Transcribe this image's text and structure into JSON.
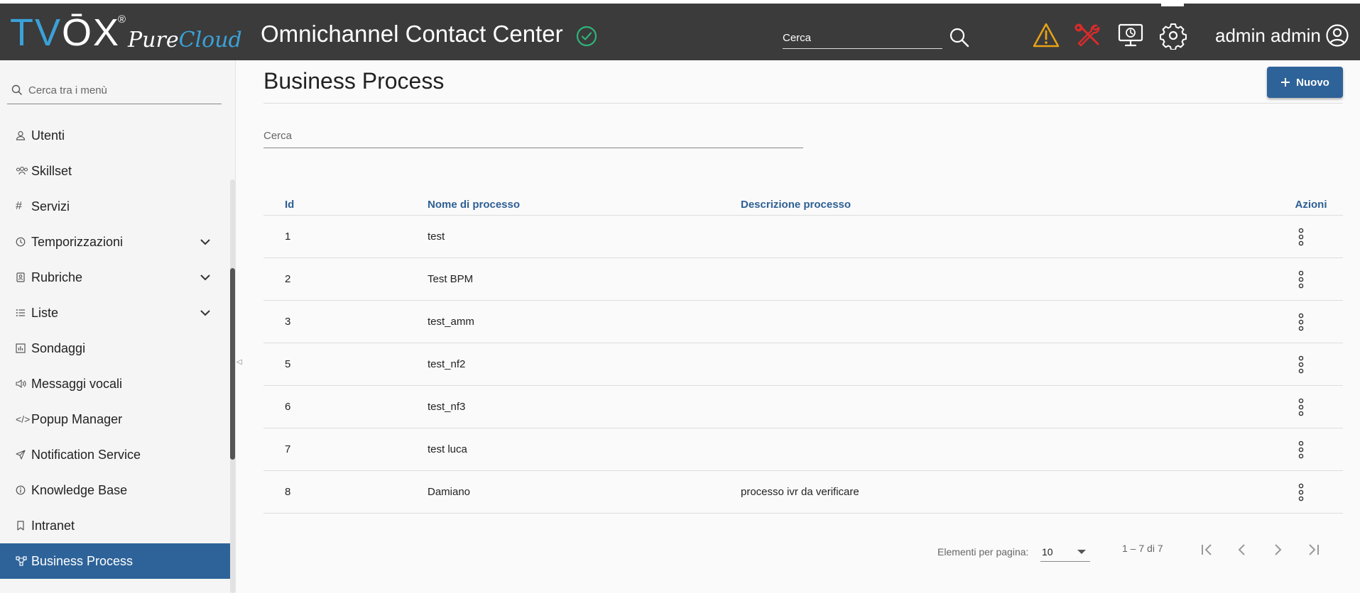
{
  "header": {
    "logo_text": "TVOX",
    "logo_reg": "®",
    "logo_sub1": "Pure",
    "logo_sub2": "Cloud",
    "app_title": "Omnichannel Contact Center",
    "search_placeholder": "Cerca",
    "user_name": "admin admin",
    "icons": [
      "check-circle-icon",
      "search-icon",
      "warning-icon",
      "tools-icon",
      "monitor-clock-icon",
      "gear-icon",
      "user-circle-icon"
    ],
    "colors": {
      "bar": "#3b3b3b",
      "brand": "#3ba1d8",
      "warning": "#e8a317",
      "tools": "#d92b2b",
      "ok": "#2fb37a"
    }
  },
  "sidebar": {
    "search_placeholder": "Cerca tra i menù",
    "items": [
      {
        "label": "Utenti",
        "icon": "user-icon",
        "expandable": false,
        "active": false
      },
      {
        "label": "Skillset",
        "icon": "users-group-icon",
        "expandable": false,
        "active": false
      },
      {
        "label": "Servizi",
        "icon": "hash-icon",
        "expandable": false,
        "active": false
      },
      {
        "label": "Temporizzazioni",
        "icon": "clock-icon",
        "expandable": true,
        "active": false
      },
      {
        "label": "Rubriche",
        "icon": "address-book-icon",
        "expandable": true,
        "active": false
      },
      {
        "label": "Liste",
        "icon": "list-icon",
        "expandable": true,
        "active": false
      },
      {
        "label": "Sondaggi",
        "icon": "chart-icon",
        "expandable": false,
        "active": false
      },
      {
        "label": "Messaggi vocali",
        "icon": "speaker-icon",
        "expandable": false,
        "active": false
      },
      {
        "label": "Popup Manager",
        "icon": "code-icon",
        "expandable": false,
        "active": false
      },
      {
        "label": "Notification Service",
        "icon": "send-icon",
        "expandable": false,
        "active": false
      },
      {
        "label": "Knowledge Base",
        "icon": "info-icon",
        "expandable": false,
        "active": false
      },
      {
        "label": "Intranet",
        "icon": "bookmark-icon",
        "expandable": false,
        "active": false
      },
      {
        "label": "Business Process",
        "icon": "flow-icon",
        "expandable": false,
        "active": true
      }
    ],
    "active_color": "#2e6399"
  },
  "main": {
    "title": "Business Process",
    "new_button": "Nuovo",
    "search_placeholder": "Cerca",
    "columns": {
      "id": "Id",
      "name": "Nome di processo",
      "desc": "Descrizione processo",
      "actions": "Azioni"
    },
    "rows": [
      {
        "id": "1",
        "name": "test",
        "desc": ""
      },
      {
        "id": "2",
        "name": "Test BPM",
        "desc": ""
      },
      {
        "id": "3",
        "name": "test_amm",
        "desc": ""
      },
      {
        "id": "5",
        "name": "test_nf2",
        "desc": ""
      },
      {
        "id": "6",
        "name": "test_nf3",
        "desc": ""
      },
      {
        "id": "7",
        "name": "test luca",
        "desc": ""
      },
      {
        "id": "8",
        "name": "Damiano",
        "desc": "processo ivr da verificare"
      }
    ],
    "pagination": {
      "label": "Elementi per pagina:",
      "page_size": "10",
      "range": "1 – 7 di 7"
    }
  }
}
